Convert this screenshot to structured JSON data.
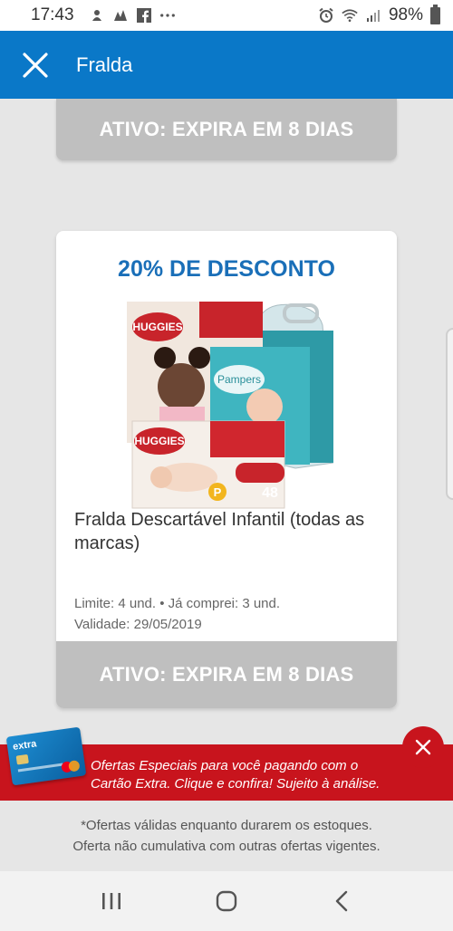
{
  "status_bar": {
    "time": "17:43",
    "battery": "98%",
    "icons_left": [
      "notification-icon",
      "notification-icon",
      "facebook-icon",
      "more-icon"
    ],
    "icons_right": [
      "alarm-icon",
      "wifi-icon",
      "signal-icon",
      "battery-icon"
    ]
  },
  "app_bar": {
    "title": "Fralda",
    "close_icon": "close-icon",
    "color": "#0a78c8"
  },
  "top_card": {
    "status": "ATIVO: EXPIRA EM 8 DIAS"
  },
  "offer": {
    "discount": "20% DE DESCONTO",
    "product_name": "Fralda Descartável Infantil (todas as marcas)",
    "limit_line": "Limite:  4 und. • Já comprei: 3 und.",
    "validity_line": "Validade:  29/05/2019",
    "status": "ATIVO: EXPIRA EM 8 DIAS",
    "discount_color": "#1a6fb8",
    "pack_size": "48",
    "size_badge": "P",
    "image_brands": [
      "HUGGIES",
      "Pampers",
      "HUGGIES"
    ]
  },
  "banner": {
    "line1": "Ofertas Especiais para você pagando com o",
    "line2": "Cartão Extra. Clique e confira! Sujeito à análise.",
    "card_brand": "extra",
    "color": "#c8141d"
  },
  "footer_note": {
    "line1": "*Ofertas válidas enquanto durarem os estoques.",
    "line2": "Oferta não cumulativa com outras ofertas vigentes."
  },
  "nav": {
    "items": [
      "recent-apps-icon",
      "home-icon",
      "back-icon"
    ]
  }
}
